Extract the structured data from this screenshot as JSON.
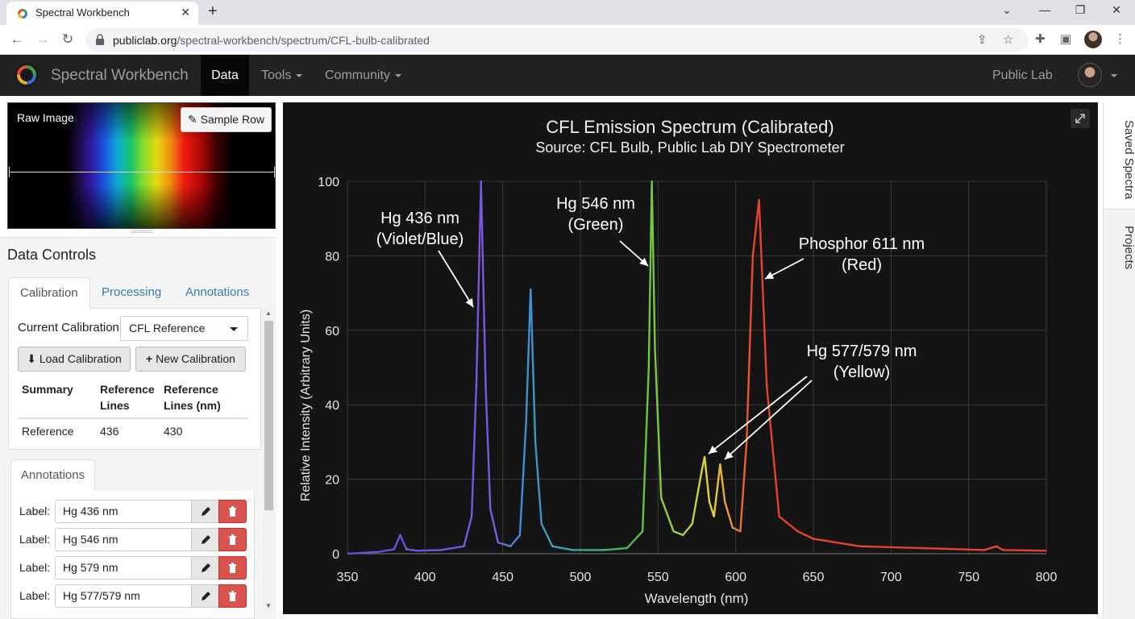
{
  "browser": {
    "tab_title": "Spectral Workbench",
    "url_host": "publiclab.org",
    "url_path": "/spectral-workbench/spectrum/CFL-bulb-calibrated"
  },
  "navbar": {
    "brand": "Spectral Workbench",
    "items": [
      "Data",
      "Tools",
      "Community"
    ],
    "user": "Public Lab"
  },
  "raw_image": {
    "label": "Raw Image",
    "sample_button": "Sample Row"
  },
  "data_controls": {
    "title": "Data Controls",
    "tabs": [
      "Calibration",
      "Processing",
      "Annotations"
    ],
    "current_calibration_label": "Current Calibration:",
    "current_calibration_value": "CFL Reference",
    "load_button": "Load Calibration",
    "new_button": "New Calibration",
    "table": {
      "headers": [
        "Summary",
        "Reference Lines",
        "Reference Lines (nm)"
      ],
      "rows": [
        [
          "Reference",
          "436",
          "430"
        ]
      ]
    }
  },
  "annotations": {
    "tab": "Annotations",
    "label_prefix": "Label:",
    "items": [
      "Hg 436 nm",
      "Hg 546 nm",
      "Hg 579 nm",
      "Hg 577/579 nm"
    ]
  },
  "sidebar": {
    "tabs": [
      "Saved Spectra",
      "Projects"
    ]
  },
  "chart_data": {
    "type": "line",
    "title": "CFL Emission Spectrum (Calibrated)",
    "subtitle": "Source: CFL Bulb, Public Lab DIY Spectrometer",
    "xlabel": "Wavelength (nm)",
    "ylabel": "Relative Intensity (Arbitrary Units)",
    "xlim": [
      350,
      800
    ],
    "ylim": [
      0,
      100
    ],
    "xticks": [
      350,
      400,
      450,
      500,
      550,
      600,
      650,
      700,
      750,
      800
    ],
    "yticks": [
      0,
      20,
      40,
      60,
      80,
      100
    ],
    "grid": true,
    "x": [
      350,
      370,
      380,
      384,
      388,
      395,
      410,
      425,
      430,
      433,
      436,
      439,
      442,
      447,
      455,
      461,
      465,
      468,
      471,
      475,
      482,
      495,
      515,
      530,
      540,
      544,
      546,
      548,
      552,
      560,
      566,
      572,
      578,
      580,
      583,
      586,
      590,
      593,
      598,
      603,
      607,
      611,
      615,
      620,
      628,
      640,
      650,
      680,
      720,
      760,
      768,
      772,
      800
    ],
    "values": [
      0,
      0.5,
      1.2,
      5,
      1.2,
      0.8,
      1,
      2,
      10,
      45,
      100,
      45,
      12,
      3,
      2,
      5,
      35,
      71,
      30,
      8,
      2,
      1,
      1,
      1.5,
      6,
      50,
      100,
      55,
      15,
      6,
      5,
      8,
      22,
      26,
      14,
      10,
      24,
      14,
      7,
      6,
      30,
      80,
      95,
      45,
      10,
      6,
      4,
      2,
      1.5,
      1,
      2,
      1,
      0.8
    ],
    "line_colors": [
      "#6a4bd6",
      "#8a5ce6",
      "#3f8fd6",
      "#48b848",
      "#9bd33c",
      "#e8d43a",
      "#e8412c"
    ],
    "annotations": [
      {
        "text": "Hg 436 nm",
        "text2": "(Violet/Blue)",
        "x": 436,
        "y": 100
      },
      {
        "text": "Hg 546 nm",
        "text2": "(Green)",
        "x": 546,
        "y": 100
      },
      {
        "text": "Phosphor 611 nm",
        "text2": "(Red)",
        "x": 611,
        "y": 100
      },
      {
        "text": "Hg 577/579 nm",
        "text2": "(Yellow)",
        "x": 579,
        "y": 26
      }
    ]
  }
}
